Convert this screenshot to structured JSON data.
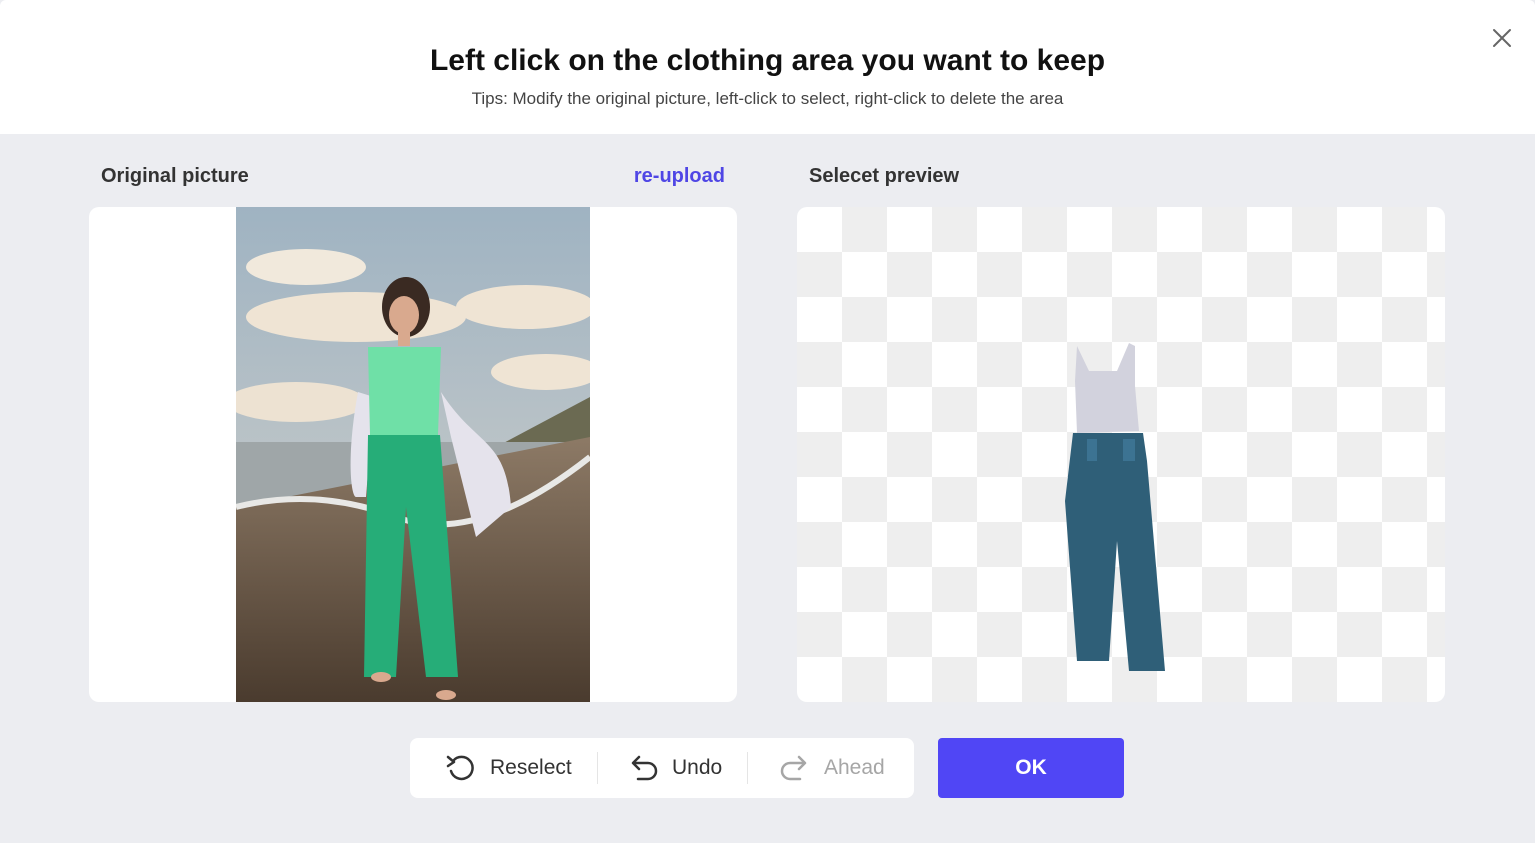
{
  "header": {
    "title": "Left click on the clothing area you want to keep",
    "tips": "Tips: Modify the original picture, left-click to select, right-click to delete the area"
  },
  "original": {
    "label": "Original picture",
    "reupload_label": "re-upload"
  },
  "preview": {
    "label": "Selecet preview"
  },
  "toolbar": {
    "reselect_label": "Reselect",
    "undo_label": "Undo",
    "ahead_label": "Ahead"
  },
  "ok_label": "OK",
  "icons": {
    "close": "close-icon",
    "reselect": "reselect-icon",
    "undo": "undo-icon",
    "ahead": "redo-icon"
  },
  "colors": {
    "accent": "#5046f5",
    "link": "#4f46e5",
    "background": "#ecedf1"
  }
}
